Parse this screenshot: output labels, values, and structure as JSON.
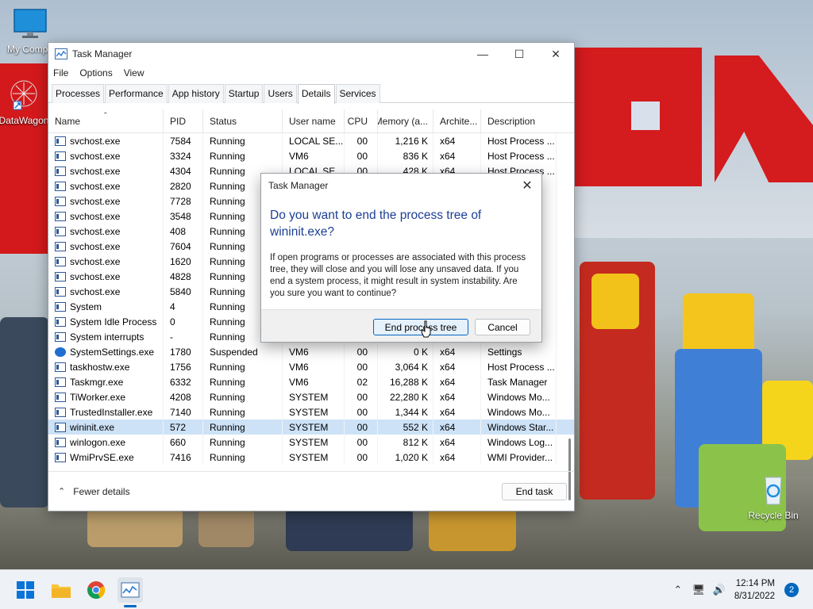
{
  "desktop": {
    "icons": [
      {
        "label": "My Compu",
        "icon": "monitor-icon"
      },
      {
        "label": "DataWagon",
        "icon": "datawagon-icon"
      },
      {
        "label": "Recycle Bin",
        "icon": "recycle-bin-icon"
      }
    ]
  },
  "task_manager": {
    "title": "Task Manager",
    "menu": [
      "File",
      "Options",
      "View"
    ],
    "tabs": [
      "Processes",
      "Performance",
      "App history",
      "Startup",
      "Users",
      "Details",
      "Services"
    ],
    "active_tab": "Details",
    "columns": [
      "Name",
      "PID",
      "Status",
      "User name",
      "CPU",
      "Memory (a...",
      "Archite...",
      "Description"
    ],
    "rows": [
      [
        "svchost.exe",
        "7584",
        "Running",
        "LOCAL SE...",
        "00",
        "1,216 K",
        "x64",
        "Host Process ..."
      ],
      [
        "svchost.exe",
        "3324",
        "Running",
        "VM6",
        "00",
        "836 K",
        "x64",
        "Host Process ..."
      ],
      [
        "svchost.exe",
        "4304",
        "Running",
        "LOCAL SE...",
        "00",
        "428 K",
        "x64",
        "Host Process ..."
      ],
      [
        "svchost.exe",
        "2820",
        "Running",
        "",
        "",
        "",
        "",
        "s ..."
      ],
      [
        "svchost.exe",
        "7728",
        "Running",
        "",
        "",
        "",
        "",
        "s ..."
      ],
      [
        "svchost.exe",
        "3548",
        "Running",
        "",
        "",
        "",
        "",
        "s ..."
      ],
      [
        "svchost.exe",
        "408",
        "Running",
        "",
        "",
        "",
        "",
        "s ..."
      ],
      [
        "svchost.exe",
        "7604",
        "Running",
        "",
        "",
        "",
        "",
        "s ..."
      ],
      [
        "svchost.exe",
        "1620",
        "Running",
        "",
        "",
        "",
        "",
        "s ..."
      ],
      [
        "svchost.exe",
        "4828",
        "Running",
        "",
        "",
        "",
        "",
        "s ..."
      ],
      [
        "svchost.exe",
        "5840",
        "Running",
        "",
        "",
        "",
        "",
        "s ..."
      ],
      [
        "System",
        "4",
        "Running",
        "",
        "",
        "",
        "",
        "t S..."
      ],
      [
        "System Idle Process",
        "0",
        "Running",
        "",
        "",
        "",
        "",
        "of..."
      ],
      [
        "System interrupts",
        "-",
        "Running",
        "",
        "",
        "",
        "",
        "oc..."
      ],
      [
        "SystemSettings.exe",
        "1780",
        "Suspended",
        "VM6",
        "00",
        "0 K",
        "x64",
        "Settings"
      ],
      [
        "taskhostw.exe",
        "1756",
        "Running",
        "VM6",
        "00",
        "3,064 K",
        "x64",
        "Host Process ..."
      ],
      [
        "Taskmgr.exe",
        "6332",
        "Running",
        "VM6",
        "02",
        "16,288 K",
        "x64",
        "Task Manager"
      ],
      [
        "TiWorker.exe",
        "4208",
        "Running",
        "SYSTEM",
        "00",
        "22,280 K",
        "x64",
        "Windows Mo..."
      ],
      [
        "TrustedInstaller.exe",
        "7140",
        "Running",
        "SYSTEM",
        "00",
        "1,344 K",
        "x64",
        "Windows Mo..."
      ],
      [
        "wininit.exe",
        "572",
        "Running",
        "SYSTEM",
        "00",
        "552 K",
        "x64",
        "Windows Star..."
      ],
      [
        "winlogon.exe",
        "660",
        "Running",
        "SYSTEM",
        "00",
        "812 K",
        "x64",
        "Windows Log..."
      ],
      [
        "WmiPrvSE.exe",
        "7416",
        "Running",
        "SYSTEM",
        "00",
        "1,020 K",
        "x64",
        "WMI Provider..."
      ]
    ],
    "selected_row": 19,
    "fewer_details": "Fewer details",
    "end_task": "End task"
  },
  "dialog": {
    "title": "Task Manager",
    "heading": "Do you want to end the process tree of wininit.exe?",
    "body": "If open programs or processes are associated with this process tree, they will close and you will lose any unsaved data. If you end a system process, it might result in system instability. Are you sure you want to continue?",
    "primary_button": "End process tree",
    "cancel_button": "Cancel"
  },
  "taskbar": {
    "time": "12:14 PM",
    "date": "8/31/2022",
    "notifications": "2"
  },
  "colors": {
    "accent": "#0067c0",
    "heading": "#1c3f94",
    "selection": "#cde2f7"
  }
}
